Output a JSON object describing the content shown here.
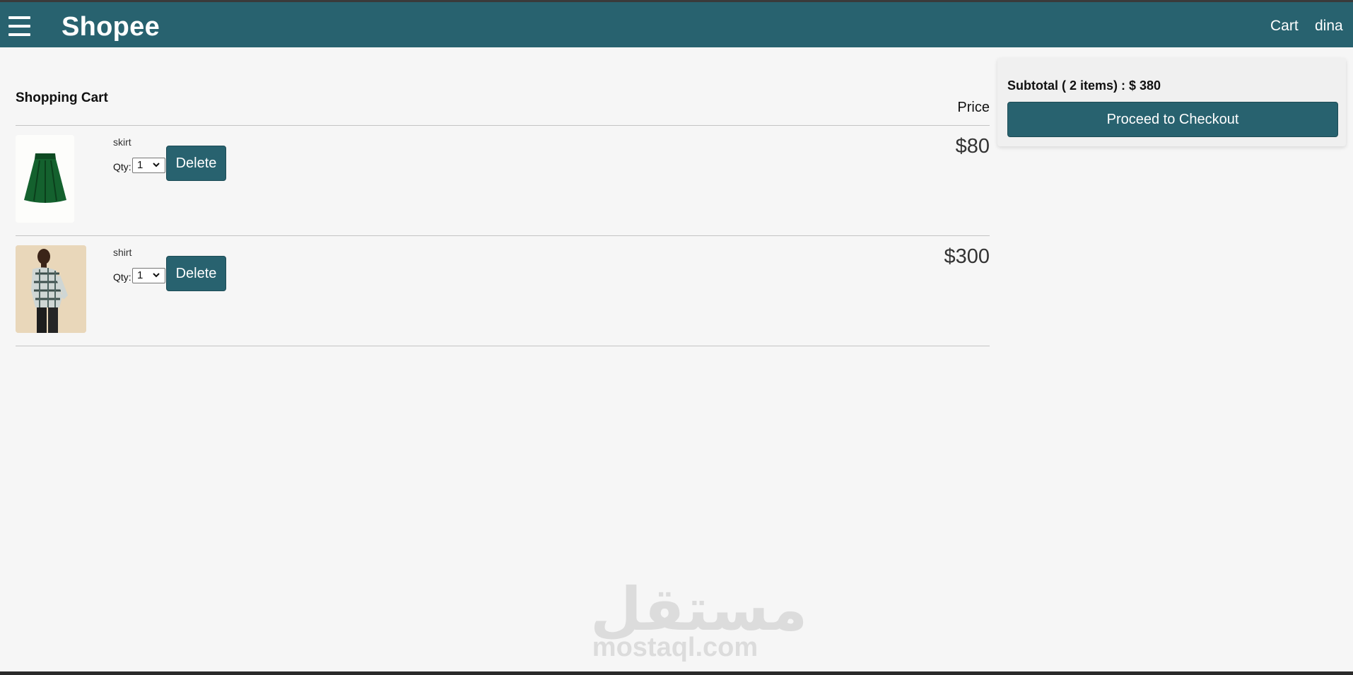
{
  "header": {
    "brand": "Shopee",
    "nav": {
      "cart_label": "Cart",
      "user_label": "dina"
    },
    "color": "#28626f"
  },
  "cart": {
    "title": "Shopping Cart",
    "price_heading": "Price",
    "items": [
      {
        "name": "skirt",
        "qty_label": "Qty:",
        "qty_value": "1",
        "delete_label": "Delete",
        "price": "$80",
        "image": "green skirt photo"
      },
      {
        "name": "shirt",
        "qty_label": "Qty:",
        "qty_value": "1",
        "delete_label": "Delete",
        "price": "$300",
        "image": "man in plaid shirt photo"
      }
    ]
  },
  "summary": {
    "subtotal_text": "Subtotal ( 2 items) : $ 380",
    "checkout_label": "Proceed to Checkout"
  },
  "watermark": {
    "arabic": "مستقل",
    "latin": "mostaql.com"
  }
}
